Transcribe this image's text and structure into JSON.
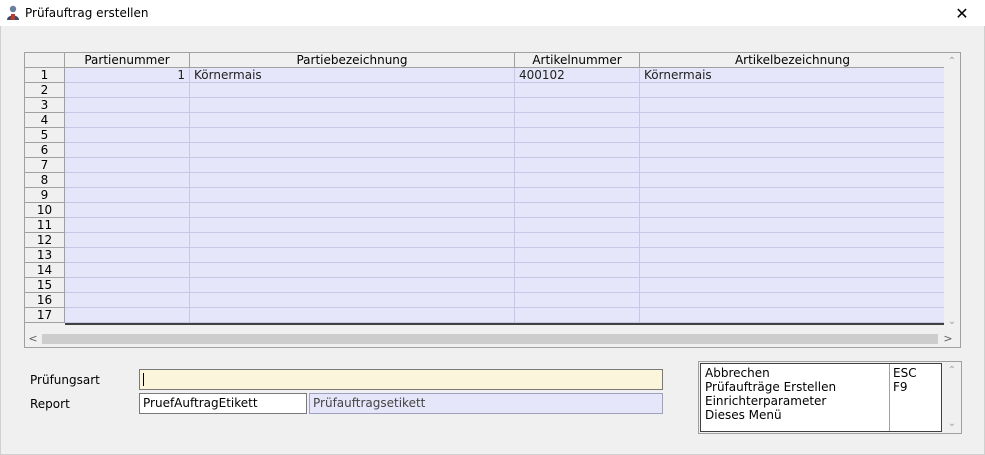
{
  "window": {
    "title": "Prüfauftrag erstellen",
    "close_glyph": "✕"
  },
  "grid": {
    "columns": [
      "Partienummer",
      "Partiebezeichnung",
      "Artikelnummer",
      "Artikelbezeichnung"
    ],
    "row_numbers": [
      "1",
      "2",
      "3",
      "4",
      "5",
      "6",
      "7",
      "8",
      "9",
      "10",
      "11",
      "12",
      "13",
      "14",
      "15",
      "16",
      "17"
    ],
    "rows": [
      {
        "partienummer": "1",
        "partiebezeichnung": "Körnermais",
        "artikelnummer": "400102",
        "artikelbezeichnung": "Körnermais"
      }
    ],
    "scroll": {
      "up": "⌃",
      "down": "⌄",
      "left": "<",
      "right": ">"
    }
  },
  "form": {
    "pruefungsart_label": "Prüfungsart",
    "pruefungsart_value": "",
    "report_label": "Report",
    "report_value": "PruefAuftragEtikett",
    "report_description": "Prüfauftragsetikett"
  },
  "menu": {
    "items": [
      {
        "label": "Abbrechen",
        "key": "ESC"
      },
      {
        "label": "Prüfaufträge Erstellen",
        "key": "F9"
      },
      {
        "label": "Einrichterparameter",
        "key": ""
      },
      {
        "label": "Dieses Menü",
        "key": ""
      }
    ]
  },
  "colors": {
    "grid_body": "#e6e6fa",
    "input_yellow": "#fbf5dc",
    "readonly_lavender": "#e6e6fa"
  },
  "icons": {
    "app": "user-icon",
    "close": "close-icon"
  }
}
